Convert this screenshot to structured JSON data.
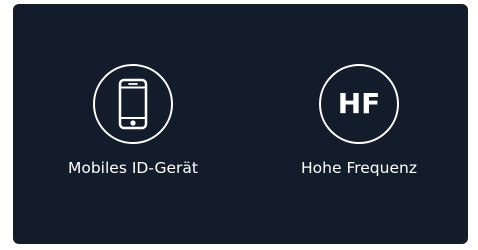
{
  "features": [
    {
      "icon": "smartphone-icon",
      "label": "Mobiles ID-Gerät"
    },
    {
      "icon": "hf-icon",
      "icon_text": "HF",
      "label": "Hohe Frequenz"
    }
  ],
  "colors": {
    "card_background": "#131c2b",
    "foreground": "#ffffff",
    "page_background": "#ffffff"
  }
}
